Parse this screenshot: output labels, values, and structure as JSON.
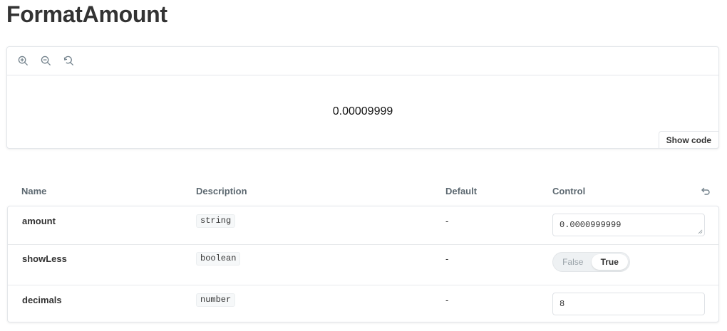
{
  "title": "FormatAmount",
  "toolbar": {
    "icons": [
      "zoom-in-icon",
      "zoom-out-icon",
      "reset-zoom-icon"
    ]
  },
  "preview": {
    "value": "0.00009999",
    "show_code_label": "Show code"
  },
  "args_table": {
    "headers": {
      "name": "Name",
      "description": "Description",
      "default": "Default",
      "control": "Control"
    },
    "rows": [
      {
        "name": "amount",
        "type": "string",
        "default": "-",
        "control_type": "text",
        "value": "0.0000999999"
      },
      {
        "name": "showLess",
        "type": "boolean",
        "default": "-",
        "control_type": "boolean",
        "false_label": "False",
        "true_label": "True",
        "value": true
      },
      {
        "name": "decimals",
        "type": "number",
        "default": "-",
        "control_type": "number",
        "value": "8"
      }
    ]
  },
  "colors": {
    "border": "#e3e6ea",
    "text": "#333333",
    "muted": "#5c6870"
  }
}
